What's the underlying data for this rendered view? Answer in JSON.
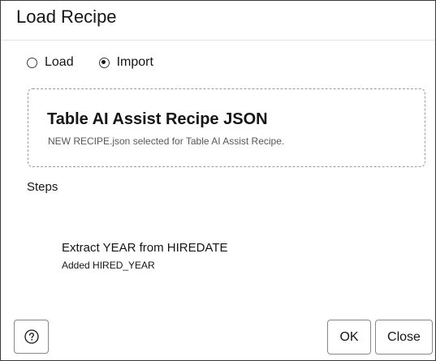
{
  "dialog": {
    "title": "Load Recipe"
  },
  "source_options": [
    {
      "label": "Load",
      "selected": false
    },
    {
      "label": "Import",
      "selected": true
    }
  ],
  "drop_zone": {
    "title": "Table AI Assist Recipe JSON",
    "subtitle": "NEW RECIPE.json selected for Table AI Assist Recipe."
  },
  "steps": {
    "label": "Steps",
    "items": [
      {
        "title": "Extract YEAR from HIREDATE",
        "detail": "Added HIRED_YEAR"
      }
    ]
  },
  "footer": {
    "help_icon": "question-circle-icon",
    "ok_label": "OK",
    "close_label": "Close"
  }
}
